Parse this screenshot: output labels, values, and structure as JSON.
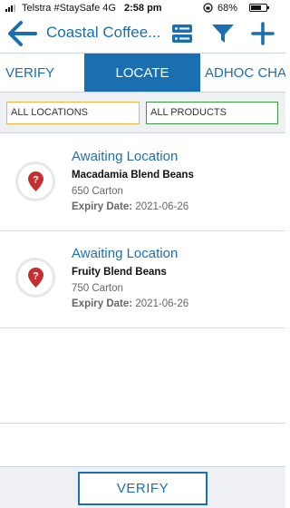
{
  "status_bar": {
    "carrier": "Telstra #StaySafe  4G",
    "time": "2:58 pm",
    "battery_percent": "68%",
    "battery_level": 0.68
  },
  "nav": {
    "title": "Coastal Coffee...",
    "back_icon": "arrow-left-icon",
    "list_icon": "server-list-icon",
    "filter_icon": "funnel-icon",
    "add_icon": "plus-icon"
  },
  "tabs": [
    {
      "label": "VERIFY"
    },
    {
      "label": "LOCATE",
      "active": true
    },
    {
      "label": "ADHOC CHAR"
    }
  ],
  "filters": {
    "location": "ALL LOCATIONS",
    "product": "ALL PRODUCTS"
  },
  "items": [
    {
      "status": "Awaiting Location",
      "product": "Macadamia Blend Beans",
      "quantity": "650 Carton",
      "expiry_label": "Expiry Date:",
      "expiry_value": "2021-06-26",
      "icon": "location-unknown-icon"
    },
    {
      "status": "Awaiting Location",
      "product": "Fruity Blend Beans",
      "quantity": "750 Carton",
      "expiry_label": "Expiry Date:",
      "expiry_value": "2021-06-26",
      "icon": "location-unknown-icon"
    }
  ],
  "footer": {
    "verify_label": "VERIFY"
  },
  "colors": {
    "accent": "#1a6fb0",
    "location_filter_border": "#f0b443",
    "product_filter_border": "#3c9a45",
    "pin": "#c62f2f"
  }
}
